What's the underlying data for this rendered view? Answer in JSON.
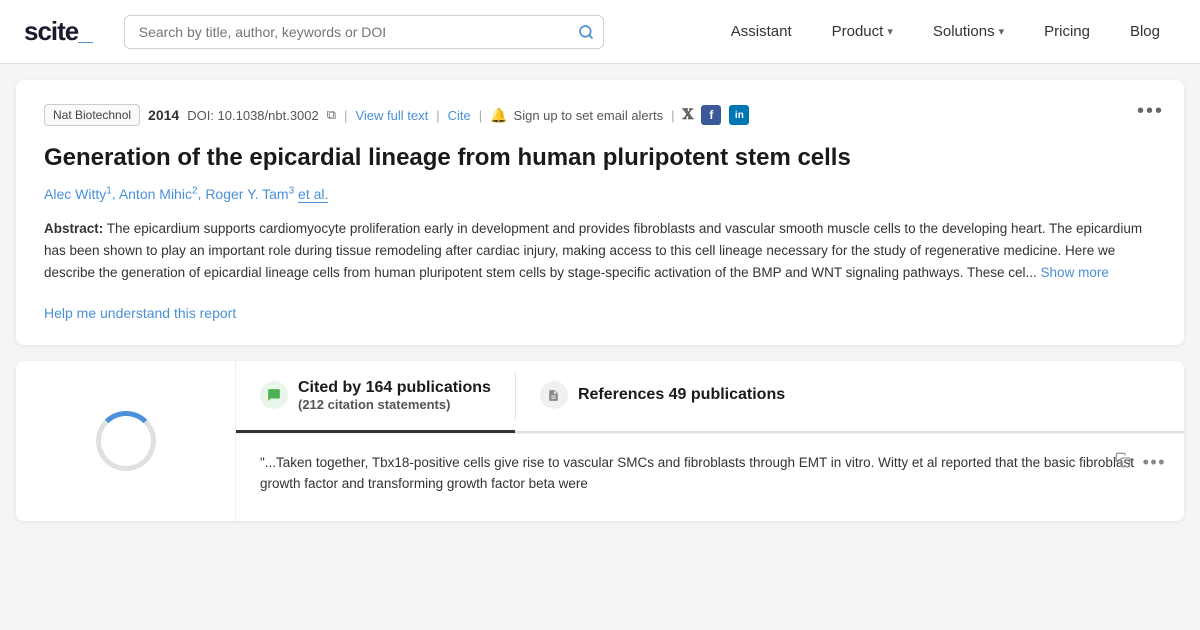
{
  "header": {
    "logo": "scite_",
    "search_placeholder": "Search by title, author, keywords or DOI",
    "nav": [
      {
        "id": "assistant",
        "label": "Assistant",
        "has_dropdown": false
      },
      {
        "id": "product",
        "label": "Product",
        "has_dropdown": true
      },
      {
        "id": "solutions",
        "label": "Solutions",
        "has_dropdown": true
      },
      {
        "id": "pricing",
        "label": "Pricing",
        "has_dropdown": false
      },
      {
        "id": "blog",
        "label": "Blog",
        "has_dropdown": false
      }
    ]
  },
  "paper": {
    "journal": "Nat Biotechnol",
    "year": "2014",
    "doi": "DOI: 10.1038/nbt.3002",
    "view_full_text": "View full text",
    "cite": "Cite",
    "alert_text": "Sign up to set email alerts",
    "title": "Generation of the epicardial lineage from human pluripotent stem cells",
    "authors": [
      {
        "name": "Alec Witty",
        "sup": "1"
      },
      {
        "name": "Anton Mihic",
        "sup": "2"
      },
      {
        "name": "Roger Y. Tam",
        "sup": "3"
      }
    ],
    "et_al": "et al.",
    "abstract_label": "Abstract:",
    "abstract_text": "The epicardium supports cardiomyocyte proliferation early in development and provides fibroblasts and vascular smooth muscle cells to the developing heart. The epicardium has been shown to play an important role during tissue remodeling after cardiac injury, making access to this cell lineage necessary for the study of regenerative medicine. Here we describe the generation of epicardial lineage cells from human pluripotent stem cells by stage-specific activation of the BMP and WNT signaling pathways. These cel...",
    "show_more": "Show more",
    "help_link": "Help me understand this report"
  },
  "citations": {
    "cited_by_count": "164",
    "cited_by_label": "Cited by 164 publications",
    "citation_statements_count": "(212 citation statements)",
    "references_label": "References 49 publications",
    "citation_card_text": "\"...Taken together, Tbx18-positive cells give rise to vascular SMCs and fibroblasts through EMT in vitro. Witty et al reported that the basic fibroblast growth factor and transforming growth factor beta were"
  },
  "icons": {
    "search": "🔍",
    "bell": "🔔",
    "twitter": "𝕏",
    "facebook": "f",
    "linkedin": "in",
    "copy": "⧉",
    "more": "•••",
    "chat_bubble": "💬",
    "document": "📋",
    "spinner": ""
  }
}
